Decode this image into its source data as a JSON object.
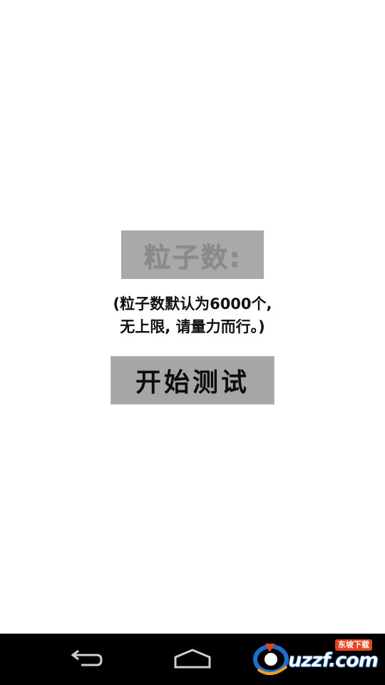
{
  "main": {
    "particle_label": "粒子数:",
    "hint_line1": "(粒子数默认为6000个,",
    "hint_line2": "无上限, 请量力而行。)",
    "start_button_label": "开始测试"
  },
  "navbar": {
    "back_icon": "back-arrow-icon",
    "home_icon": "home-icon"
  },
  "watermark": {
    "brand": "uzzf.com",
    "tag": "东坡下载"
  },
  "colors": {
    "box_gray": "#a9a9a9",
    "button_gray": "#a6a6a6",
    "navbar": "#000000",
    "logo_blue": "#1e6fd0",
    "logo_orange": "#e8431f"
  }
}
